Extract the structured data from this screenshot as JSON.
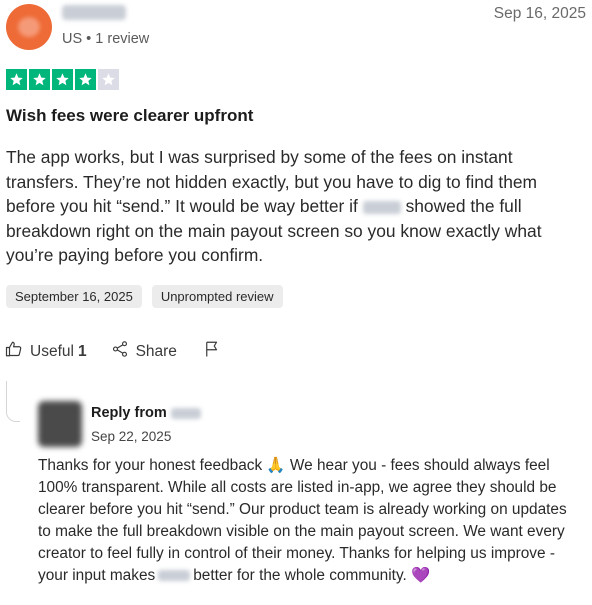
{
  "reviewer": {
    "meta": "US • 1 review",
    "date": "Sep 16, 2025"
  },
  "rating": {
    "value": 4,
    "max": 5
  },
  "colors": {
    "star_on": "#00b67a",
    "star_off": "#dcdce6",
    "avatar": "#ee6a36"
  },
  "review": {
    "title": "Wish fees were clearer upfront",
    "body_part1": "The app works, but I was surprised by some of the fees on instant transfers. They’re not hidden exactly, but you have to dig to find them before you hit “send.” It would be way better if",
    "body_part2": "showed the full breakdown right on the main payout screen so you know exactly what you’re paying before you confirm.",
    "date_chip": "September 16, 2025",
    "type_chip": "Unprompted review"
  },
  "actions": {
    "useful_label": "Useful",
    "useful_count": "1",
    "share_label": "Share"
  },
  "reply": {
    "title_prefix": "Reply from",
    "date": "Sep 22, 2025",
    "body_part1": "Thanks for your honest feedback 🙏 We hear you - fees should always feel 100% transparent. While all costs are listed in-app, we agree they should be clearer before you hit “send.” Our product team is already working on updates to make the full breakdown visible on the main payout screen. We want every creator to feel fully in control of their money. Thanks for helping us improve - your input makes",
    "body_part2": "better for the whole community. 💜"
  }
}
